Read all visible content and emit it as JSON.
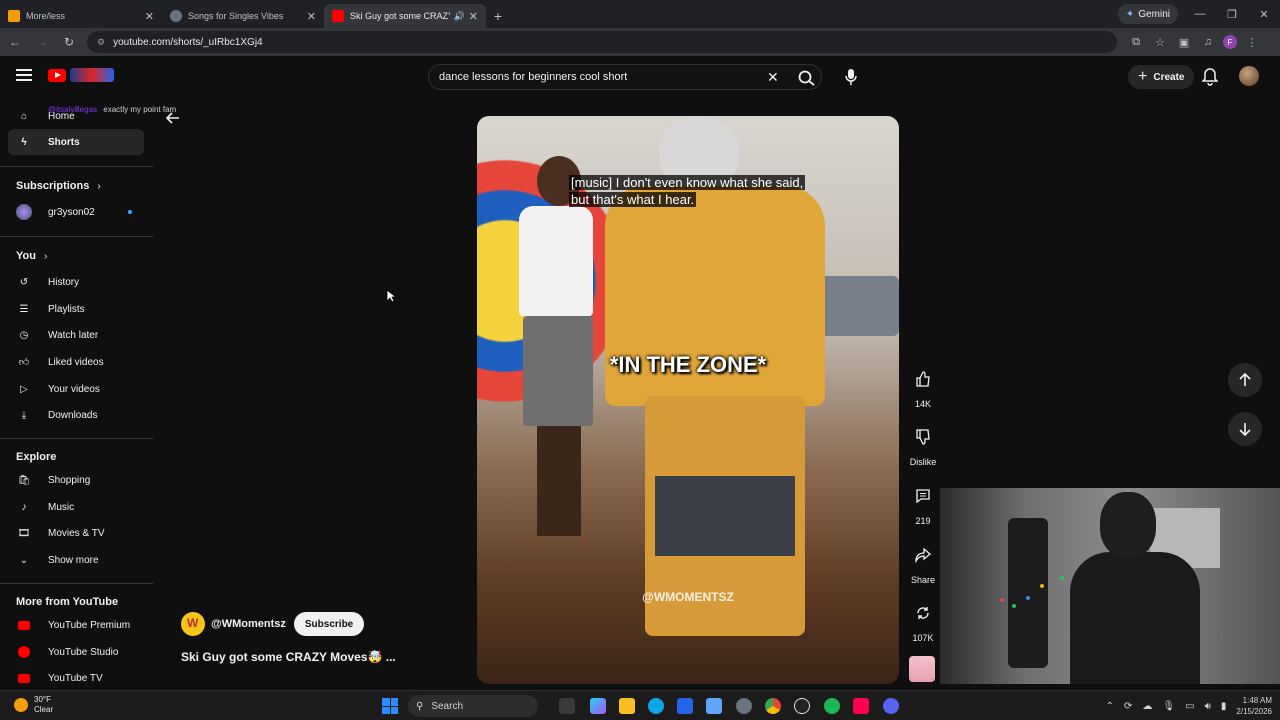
{
  "browser": {
    "tabs": [
      {
        "title": "More/less",
        "fav_color": "#f59e0b"
      },
      {
        "title": "Songs for Singles Vibes",
        "fav_color": "#6b7280"
      },
      {
        "title": "Ski Guy got some CRAZY M",
        "fav_color": "#ff0000",
        "active": true
      }
    ],
    "gemini_label": "Gemini",
    "url": "youtube.com/shorts/_uIRbc1XGj4",
    "profile_initial": "F"
  },
  "header": {
    "search_value": "dance lessons for beginners cool short",
    "create_label": "Create"
  },
  "overlay_chat": {
    "user": "@itsalvillegas",
    "message": "exactly my point fam"
  },
  "sidebar": {
    "home": "Home",
    "shorts": "Shorts",
    "subscriptions": "Subscriptions",
    "subscription_channel": "gr3yson02",
    "you": "You",
    "you_items": [
      "History",
      "Playlists",
      "Watch later",
      "Liked videos",
      "Your videos",
      "Downloads"
    ],
    "explore": "Explore",
    "explore_items": [
      "Shopping",
      "Music",
      "Movies & TV",
      "Show more"
    ],
    "more_from": "More from YouTube",
    "more_items": [
      "YouTube Premium",
      "YouTube Studio",
      "YouTube TV"
    ]
  },
  "video": {
    "caption_line1": "[music] I don't even know what she said,",
    "caption_line2": "but that's what I hear.",
    "overlay_text": "*IN THE ZONE*",
    "watermark": "@WMOMENTSZ"
  },
  "channel": {
    "name": "@WMomentsz",
    "subscribe_label": "Subscribe",
    "title": "Ski Guy got some CRAZY Moves🤯 ..."
  },
  "actions": {
    "likes": "14K",
    "dislike_label": "Dislike",
    "comments": "219",
    "share_label": "Share",
    "remix": "107K"
  },
  "taskbar": {
    "temp": "30°F",
    "condition": "Clear",
    "search_placeholder": "Search",
    "time": "1:48 AM",
    "date": "2/15/2026"
  }
}
